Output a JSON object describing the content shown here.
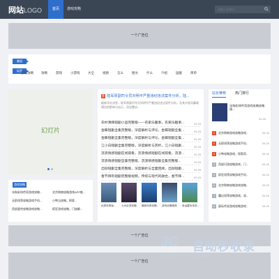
{
  "header": {
    "logo_cn": "网站",
    "logo_en": "LOGO",
    "nav": [
      "首页",
      "游戏攻略"
    ],
    "search_placeholder": "请输入关键词"
  },
  "ads": {
    "top": "一个广告位",
    "middle": "一个广告位",
    "bottom": "一个广告位"
  },
  "tags": {
    "label": "美园",
    "label2": "标签",
    "items": [
      "游戏攻略",
      "攻略",
      "游戏",
      "小游戏",
      "大全",
      "视频",
      "怎么",
      "图文",
      "什么",
      "介绍",
      "国服",
      "简单"
    ]
  },
  "slider": {
    "text": "幻灯片"
  },
  "news": {
    "badge": "荐",
    "headline": "陆军原副司令员刘明平严重违纪违法案件分析，陆...",
    "summary": "据新华社消息，陆军原副司令员刘明平严重违纪违法案件分析，及其对党风廉政建设的影响与启示，深化整治...",
    "rows": [
      "农村演绎短剧小品完整版——农家乐趣事，农家乐趣事...",
      "金蝶短剧全集完整版，深度解析与评论，金蝶短剧全集...",
      "金蝶短剧全集完整版，深度解析与评论，金蝶短剧全集...",
      "江小白短剧全集完整版，深度解析与赏析，江小白短剧...",
      "流浪情感短剧在线观看，流浪情感短剧在线观看，流浪...",
      "流浪情感短剧全集完整版，流浪情感短剧全集完整版...",
      "出狱短剧全集完整版，深度解析与全面回顾，出狱短剧...",
      "春节拜年短剧完整版视频，传统与现代的融合，春节拜..."
    ],
    "thumb_captions": [
      "优质传奇版...",
      "九州必进攻略...",
      "最新传奇攻略...",
      "游戏攻略推荐...",
      "幸运星际传说..."
    ]
  },
  "right": {
    "tab_rec": "站长推荐",
    "tab_hot": "热门排行",
    "feature_title": "冰狗彩排传奇游戏攻略攻略版...",
    "feature_date": "09-25",
    "rows": [
      {
        "num": "1",
        "title": "北京购物游戏攻略游戏...",
        "date": "09-25"
      },
      {
        "num": "2",
        "title": "无职闯荡攻略游戏手机...",
        "date": "09-25"
      },
      {
        "num": "3",
        "title": "小鸭攻略游戏，探索奇...",
        "date": "09-25"
      },
      {
        "num": "4",
        "title": "西部闪游攻略游戏，门...",
        "date": "09-25"
      },
      {
        "num": "5",
        "title": "疯狂闯荡攻略游戏手机...",
        "date": "09-25"
      },
      {
        "num": "6",
        "title": "北京购物攻略游戏攻略...",
        "date": "09-25"
      },
      {
        "num": "7",
        "title": "魔幻闯荡攻略游戏，攻...",
        "date": "09-25"
      },
      {
        "num": "8",
        "title": "星际传说游戏攻略游戏...",
        "date": "09-25"
      }
    ]
  },
  "strategy": {
    "label": "游戏攻略",
    "items": [
      "冰狗彩排传奇游戏攻略...",
      "北京购物攻略游戏APP推...",
      "无职闯荡攻略游戏手机...",
      "小鸭当攻略，探索...",
      "西部蛋完攻略游戏攻略...",
      "疯狂游戏攻略，门始解..."
    ]
  },
  "news_dates": [
    "09-25",
    "09-25",
    "09-25",
    "09-25",
    "09-25",
    "09-25",
    "09-25",
    "09-25"
  ],
  "watermark": {
    "logo": "JC",
    "title": "自动秒收录",
    "sub": "做上线排—来访一次—自动收录"
  },
  "colors": {
    "header_bg": "#3b4655",
    "accent": "#2e6fce",
    "badge_red": "#e54d26",
    "ad_bg": "#c9cdd3"
  }
}
